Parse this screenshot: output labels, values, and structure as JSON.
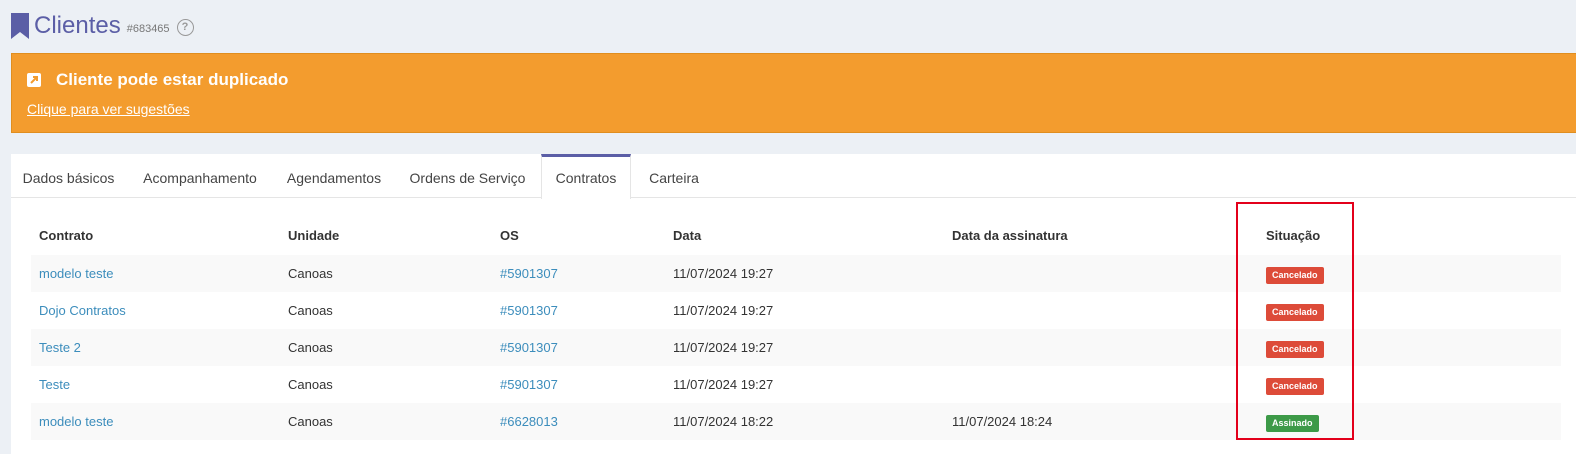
{
  "header": {
    "title": "Clientes",
    "record_id": "#683465",
    "help_glyph": "?",
    "icon": "bookmark-icon",
    "accent_color": "#5b5ea6"
  },
  "alert": {
    "title": "Cliente pode estar duplicado",
    "link": "Clique para ver sugestões",
    "icon": "external-link-icon",
    "color": "#f39c2e"
  },
  "tabs": [
    {
      "label": "Dados básicos"
    },
    {
      "label": "Acompanhamento"
    },
    {
      "label": "Agendamentos"
    },
    {
      "label": "Ordens de Serviço"
    },
    {
      "label": "Contratos",
      "active": true
    },
    {
      "label": "Carteira"
    }
  ],
  "table": {
    "headers": [
      "Contrato",
      "Unidade",
      "OS",
      "Data",
      "Data da assinatura",
      "Situação"
    ],
    "rows": [
      {
        "contrato": "modelo teste",
        "unidade": "Canoas",
        "os": "#5901307",
        "data": "11/07/2024 19:27",
        "assinatura": "",
        "situacao": "Cancelado"
      },
      {
        "contrato": "Dojo Contratos",
        "unidade": "Canoas",
        "os": "#5901307",
        "data": "11/07/2024 19:27",
        "assinatura": "",
        "situacao": "Cancelado"
      },
      {
        "contrato": "Teste 2",
        "unidade": "Canoas",
        "os": "#5901307",
        "data": "11/07/2024 19:27",
        "assinatura": "",
        "situacao": "Cancelado"
      },
      {
        "contrato": "Teste",
        "unidade": "Canoas",
        "os": "#5901307",
        "data": "11/07/2024 19:27",
        "assinatura": "",
        "situacao": "Cancelado"
      },
      {
        "contrato": "modelo teste",
        "unidade": "Canoas",
        "os": "#6628013",
        "data": "11/07/2024 18:22",
        "assinatura": "11/07/2024 18:24",
        "situacao": "Assinado"
      }
    ]
  },
  "status_colors": {
    "Cancelado": "#dd4b39",
    "Assinado": "#3d9a48"
  },
  "highlight_color": "#e3001b"
}
